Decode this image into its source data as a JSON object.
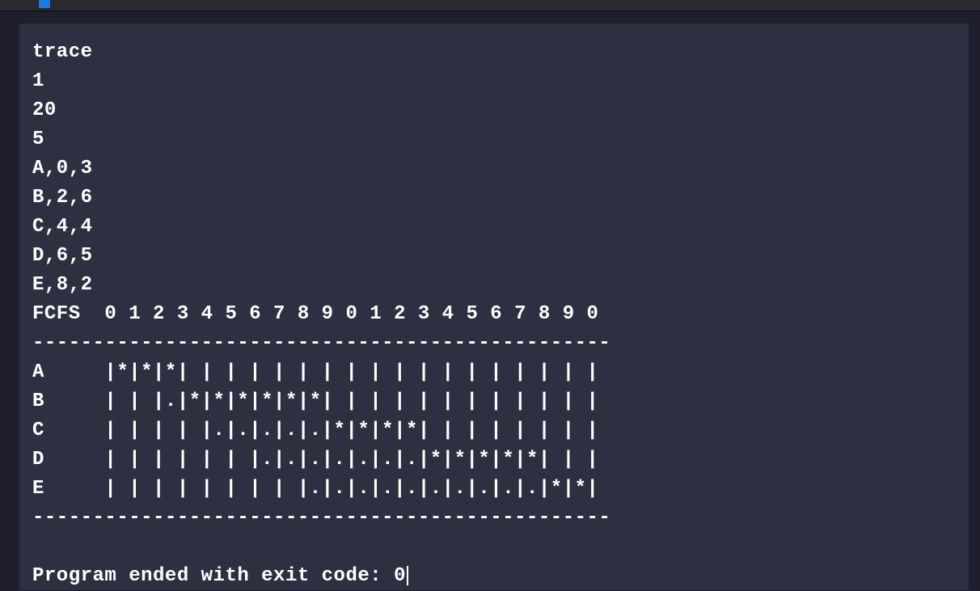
{
  "input": {
    "mode": "trace",
    "algorithm_id": "1",
    "time_quantum_or_limit": "20",
    "process_count": "5",
    "processes": [
      "A,0,3",
      "B,2,6",
      "C,4,4",
      "D,6,5",
      "E,8,2"
    ]
  },
  "trace": {
    "header": "FCFS  0 1 2 3 4 5 6 7 8 9 0 1 2 3 4 5 6 7 8 9 0 ",
    "divider": "------------------------------------------------",
    "rows": [
      "A     |*|*|*| | | | | | | | | | | | | | | | | | ",
      "B     | | |.|*|*|*|*|*|*| | | | | | | | | | | | ",
      "C     | | | | |.|.|.|.|.|*|*|*|*| | | | | | | | ",
      "D     | | | | | | |.|.|.|.|.|.|.|*|*|*|*|*| | | ",
      "E     | | | | | | | | |.|.|.|.|.|.|.|.|.|.|*|*| "
    ]
  },
  "footer": {
    "exit_message": "Program ended with exit code: 0"
  }
}
